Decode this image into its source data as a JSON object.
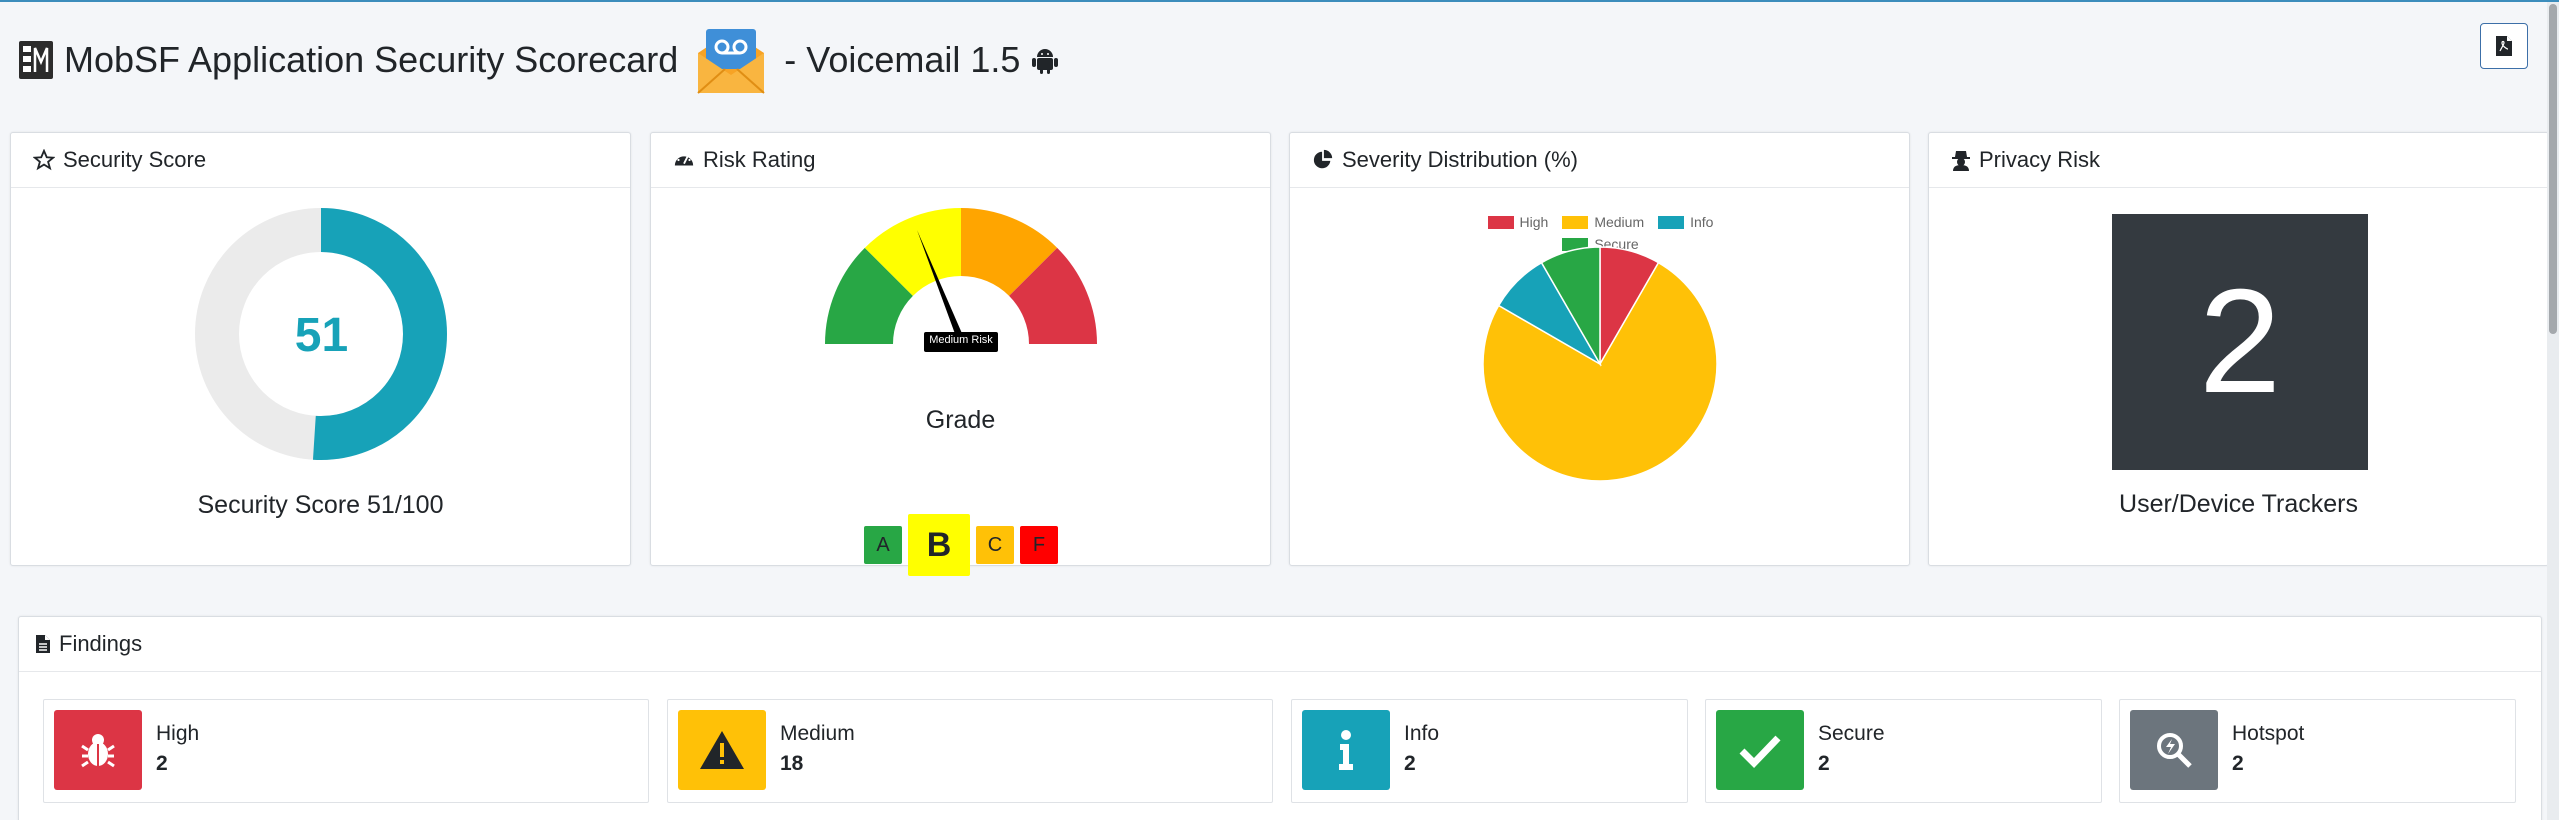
{
  "header": {
    "title": "MobSF Application Security Scorecard",
    "app_suffix": "- Voicemail 1.5",
    "pdf_icon": "pdf-file-icon"
  },
  "security_score": {
    "heading": "Security Score",
    "score": "51",
    "caption": "Security Score 51/100",
    "score_fraction": 0.51,
    "color": "#17a2b8"
  },
  "risk_rating": {
    "heading": "Risk Rating",
    "needle_label": "Medium Risk",
    "grade_label": "Grade",
    "grades": [
      {
        "letter": "A",
        "color": "#28a745"
      },
      {
        "letter": "B",
        "color": "#ffff00"
      },
      {
        "letter": "C",
        "color": "#ffc107"
      },
      {
        "letter": "F",
        "color": "#ff0000"
      }
    ],
    "current_grade": "B"
  },
  "severity": {
    "heading": "Severity Distribution (%)",
    "legend": [
      {
        "label": "High",
        "color": "#dc3545"
      },
      {
        "label": "Medium",
        "color": "#ffc107"
      },
      {
        "label": "Info",
        "color": "#17a2b8"
      },
      {
        "label": "Secure",
        "color": "#28a745"
      }
    ]
  },
  "chart_data": {
    "type": "pie",
    "title": "Severity Distribution (%)",
    "categories": [
      "High",
      "Medium",
      "Info",
      "Secure"
    ],
    "values": [
      2,
      18,
      2,
      2
    ],
    "colors": [
      "#dc3545",
      "#ffc107",
      "#17a2b8",
      "#28a745"
    ],
    "legend": "top"
  },
  "privacy": {
    "heading": "Privacy Risk",
    "count": "2",
    "caption": "User/Device Trackers"
  },
  "findings": {
    "heading": "Findings",
    "items": [
      {
        "label": "High",
        "count": "2",
        "color": "#dc3545",
        "icon": "bug-icon"
      },
      {
        "label": "Medium",
        "count": "18",
        "color": "#ffc107",
        "icon": "warning-icon"
      },
      {
        "label": "Info",
        "count": "2",
        "color": "#17a2b8",
        "icon": "info-icon"
      },
      {
        "label": "Secure",
        "count": "2",
        "color": "#28a745",
        "icon": "check-icon"
      },
      {
        "label": "Hotspot",
        "count": "2",
        "color": "#6c757d",
        "icon": "search-hotspot-icon"
      }
    ]
  }
}
